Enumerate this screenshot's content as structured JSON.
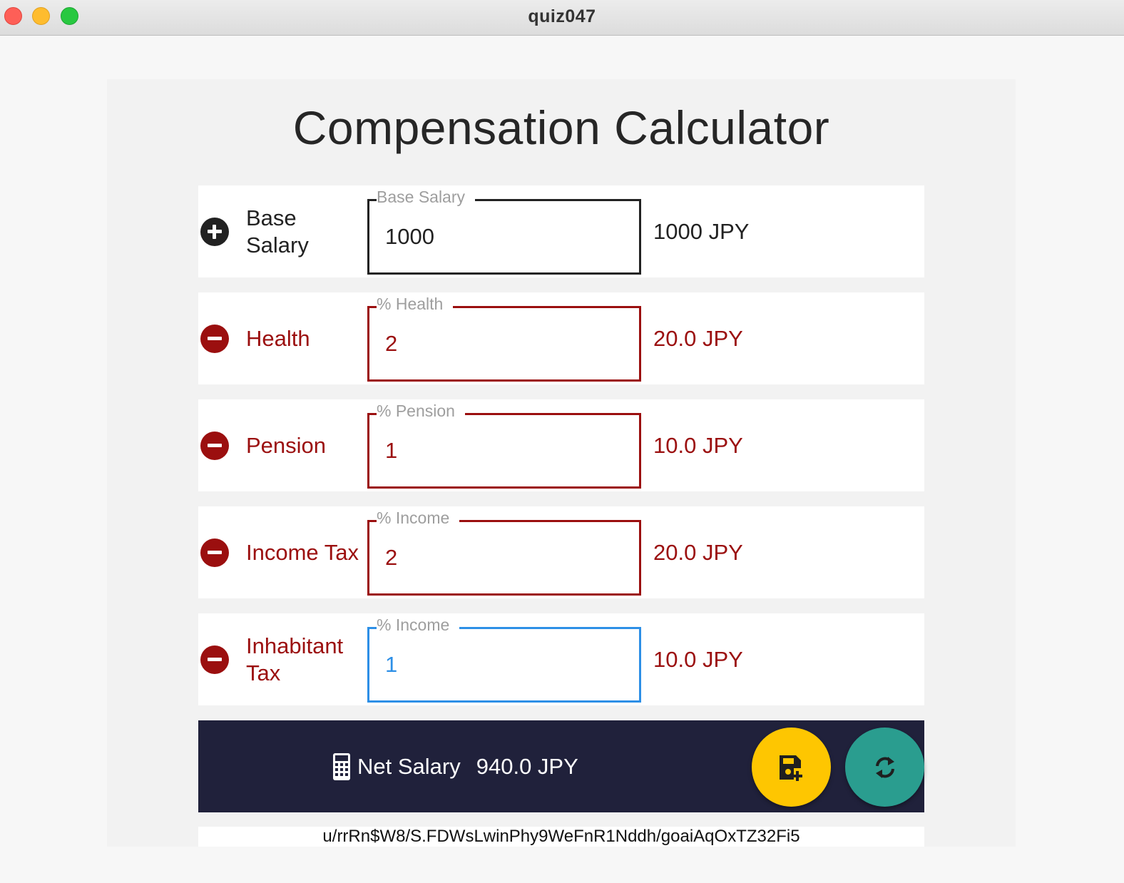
{
  "window": {
    "title": "quiz047"
  },
  "app": {
    "title": "Compensation Calculator"
  },
  "rows": [
    {
      "label": "Base Salary",
      "field_label": "Base Salary",
      "value": "1000",
      "amount": "1000 JPY",
      "sign": "plus",
      "state": "normal"
    },
    {
      "label": "Health",
      "field_label": "% Health",
      "value": "2",
      "amount": "20.0 JPY",
      "sign": "minus",
      "state": "deduction"
    },
    {
      "label": "Pension",
      "field_label": "% Pension",
      "value": "1",
      "amount": "10.0 JPY",
      "sign": "minus",
      "state": "deduction"
    },
    {
      "label": "Income Tax",
      "field_label": "% Income",
      "value": "2",
      "amount": "20.0 JPY",
      "sign": "minus",
      "state": "deduction"
    },
    {
      "label": "Inhabitant Tax",
      "field_label": "% Income",
      "value": "1",
      "amount": "10.0 JPY",
      "sign": "minus",
      "state": "focused"
    }
  ],
  "footer": {
    "net_label": "Net Salary",
    "net_value": "940.0 JPY",
    "icons": [
      "calculator-icon",
      "save-add-icon",
      "refresh-icon"
    ]
  },
  "hash": "u/rrRn$W8/S.FDWsLwinPhy9WeFnR1Nddh/goaiAqOxTZ32Fi5",
  "colors": {
    "deduction": "#9b0f0f",
    "focus": "#2d8fe6",
    "footer_bg": "#20213b",
    "save_fab": "#fec601",
    "refresh_fab": "#2a9d8f"
  }
}
